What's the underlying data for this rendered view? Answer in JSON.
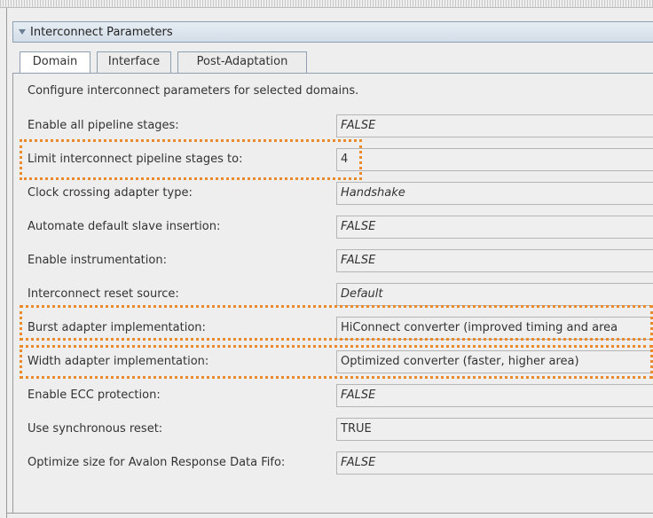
{
  "panel": {
    "title": "Interconnect Parameters"
  },
  "tabs": [
    {
      "label": "Domain",
      "active": true
    },
    {
      "label": "Interface",
      "active": false
    },
    {
      "label": "Post-Adaptation",
      "active": false
    }
  ],
  "description": "Configure interconnect parameters for selected domains.",
  "parameters": [
    {
      "label": "Enable all pipeline stages:",
      "value": "FALSE",
      "italic": true
    },
    {
      "label": "Limit interconnect pipeline stages to:",
      "value": "4",
      "italic": false,
      "highlighted": true
    },
    {
      "label": "Clock crossing adapter type:",
      "value": "Handshake",
      "italic": true
    },
    {
      "label": "Automate default slave insertion:",
      "value": "FALSE",
      "italic": true
    },
    {
      "label": "Enable instrumentation:",
      "value": "FALSE",
      "italic": true
    },
    {
      "label": "Interconnect reset source:",
      "value": "Default",
      "italic": true
    },
    {
      "label": "Burst adapter implementation:",
      "value": "HiConnect converter (improved timing and area",
      "italic": false,
      "highlighted": true
    },
    {
      "label": "Width adapter implementation:",
      "value": "Optimized converter (faster, higher area)",
      "italic": false,
      "highlighted": true
    },
    {
      "label": "Enable ECC protection:",
      "value": "FALSE",
      "italic": true
    },
    {
      "label": "Use synchronous reset:",
      "value": "TRUE",
      "italic": false
    },
    {
      "label": "Optimize size for Avalon Response Data Fifo:",
      "value": "FALSE",
      "italic": true
    }
  ],
  "colors": {
    "highlight": "#ea8a2a",
    "header": "#d3dde8"
  }
}
